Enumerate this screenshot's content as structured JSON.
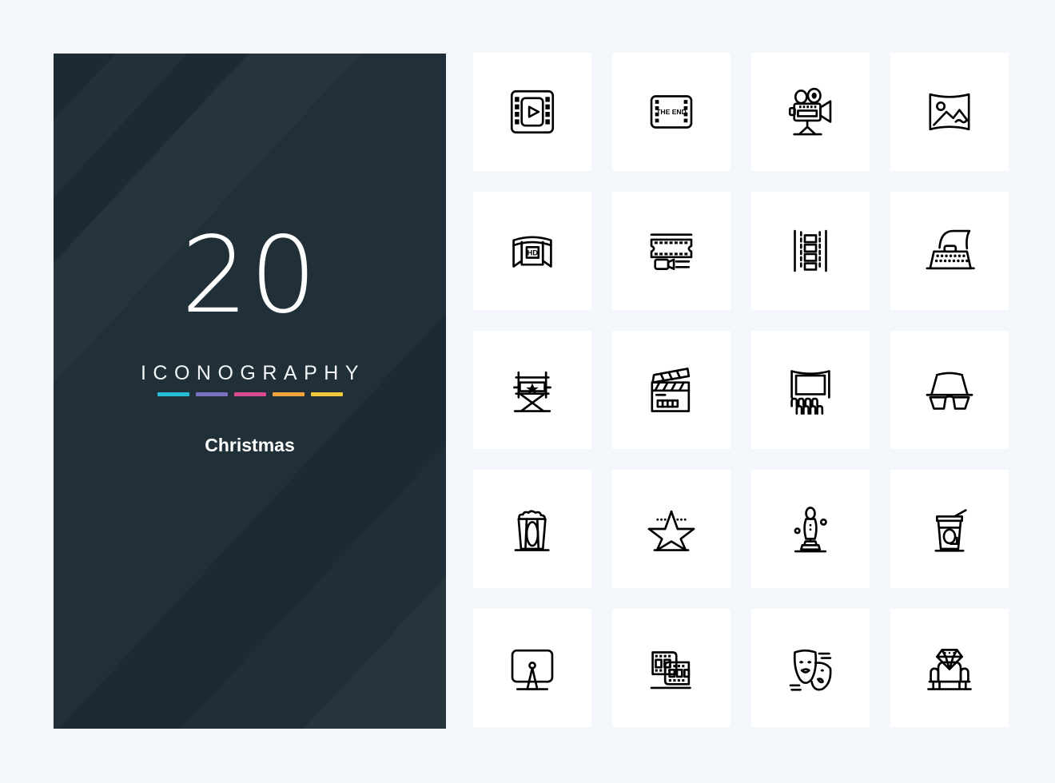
{
  "cover": {
    "count": "20",
    "subtitle": "ICONOGRAPHY",
    "name": "Christmas",
    "bar_colors": [
      "#27bcd8",
      "#7a6fc0",
      "#d94a91",
      "#f0a43a",
      "#f3c93c"
    ],
    "background_color": "#1c2b33"
  },
  "page": {
    "background_color": "#f3f6fb",
    "card_color": "#ffffff",
    "icon_color": "#000000"
  },
  "grid": {
    "columns": 4,
    "rows": 5,
    "total": 20,
    "icons": [
      {
        "id": 1,
        "name": "film-strip-play-icon",
        "label": "Video player film frame with play button"
      },
      {
        "id": 2,
        "name": "the-end-film-icon",
        "label": "Film frame reading THE END",
        "text": "THE END"
      },
      {
        "id": 3,
        "name": "movie-camera-icon",
        "label": "Movie camera on tripod"
      },
      {
        "id": 4,
        "name": "picture-image-icon",
        "label": "Picture / photograph with mountains"
      },
      {
        "id": 5,
        "name": "hd-screen-icon",
        "label": "Curved HD cinema screen",
        "text": "HD"
      },
      {
        "id": 6,
        "name": "film-reel-camera-icon",
        "label": "Film strip with small video camera"
      },
      {
        "id": 7,
        "name": "film-negative-icon",
        "label": "Vertical film negative strip"
      },
      {
        "id": 8,
        "name": "typewriter-icon",
        "label": "Typewriter with paper"
      },
      {
        "id": 9,
        "name": "director-chair-icon",
        "label": "Director's chair with star"
      },
      {
        "id": 10,
        "name": "clapperboard-icon",
        "label": "Movie clapperboard"
      },
      {
        "id": 11,
        "name": "cinema-screen-seats-icon",
        "label": "Cinema screen with audience seats"
      },
      {
        "id": 12,
        "name": "3d-glasses-icon",
        "label": "3D cinema glasses"
      },
      {
        "id": 13,
        "name": "popcorn-icon",
        "label": "Popcorn box"
      },
      {
        "id": 14,
        "name": "walk-of-fame-star-icon",
        "label": "Hollywood walk of fame star"
      },
      {
        "id": 15,
        "name": "award-statue-icon",
        "label": "Oscar award statuette on pedestal"
      },
      {
        "id": 16,
        "name": "soda-cup-icon",
        "label": "Soda drink cup with straw"
      },
      {
        "id": 17,
        "name": "tv-monitor-icon",
        "label": "Television monitor on stand"
      },
      {
        "id": 18,
        "name": "film-strips-icon",
        "label": "Two overlapping film strips"
      },
      {
        "id": 19,
        "name": "theater-masks-icon",
        "label": "Comedy and tragedy theater masks"
      },
      {
        "id": 20,
        "name": "cinema-seat-diamond-icon",
        "label": "Armchair cinema seat with diamond"
      }
    ]
  }
}
